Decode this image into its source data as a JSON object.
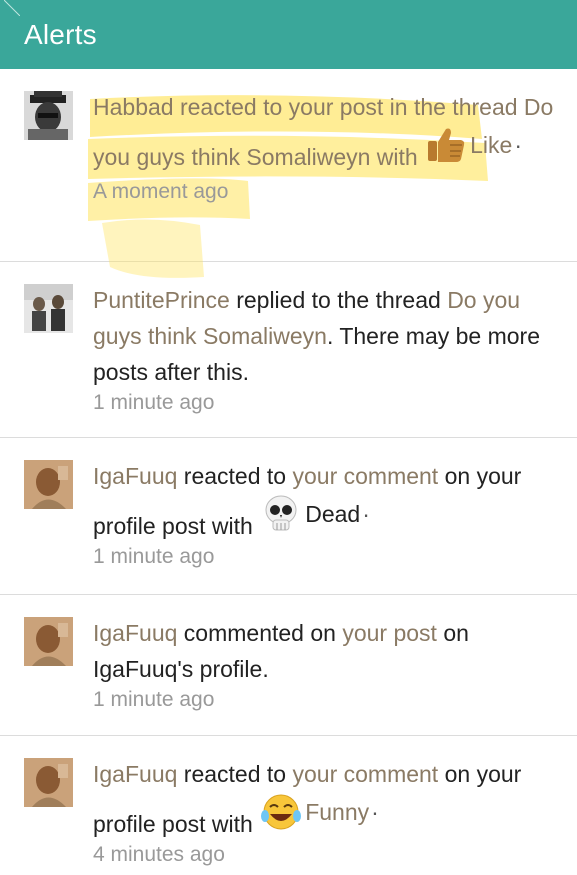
{
  "header": {
    "title": "Alerts"
  },
  "alerts": [
    {
      "user": "Habbad",
      "t1": " reacted to ",
      "l1": "your post",
      "t2": " in the thread ",
      "l2": "Do you guys think Somaliweyn",
      "t3": " with ",
      "reaction": {
        "icon": "thumbs-up-icon",
        "label": "Like"
      },
      "time": "A moment ago"
    },
    {
      "user": "PuntitePrince",
      "t1": " replied to the thread ",
      "l1": "Do you guys think Somaliweyn",
      "t2": ". There may be more posts after this.",
      "time": "1 minute ago"
    },
    {
      "user": "IgaFuuq",
      "t1": " reacted to ",
      "l1": "your comment",
      "t2": " on your profile post with ",
      "reaction": {
        "icon": "skull-icon",
        "label": "Dead"
      },
      "time": "1 minute ago"
    },
    {
      "user": "IgaFuuq",
      "t1": " commented on ",
      "l1": "your post",
      "t2": " on IgaFuuq's profile.",
      "time": "1 minute ago"
    },
    {
      "user": "IgaFuuq",
      "t1": " reacted to ",
      "l1": "your comment",
      "t2": " on your profile post with ",
      "reaction": {
        "icon": "tears-of-joy-icon",
        "label": "Funny"
      },
      "time": "4 minutes ago"
    }
  ],
  "dot": "·",
  "colors": {
    "header": "#3aa79a",
    "link": "#8a7a64",
    "highlight": "#ffe45c"
  }
}
